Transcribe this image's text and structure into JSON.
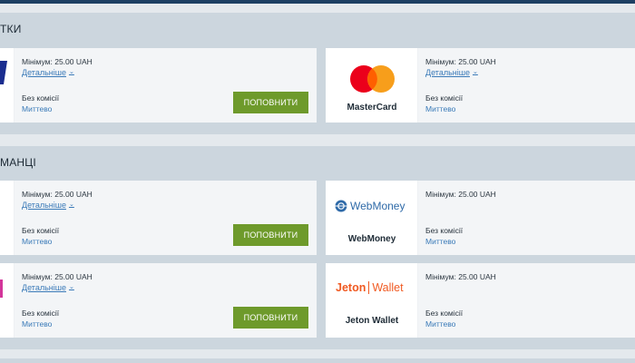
{
  "sections": [
    {
      "title": "ТКИ",
      "cards": [
        {
          "min": "Мінімум: 25.00 UAH",
          "more": "Детальніше",
          "fee": "Без комісії",
          "speed": "Миттево",
          "button": "ПОПОВНИТИ",
          "logo": "visa-partial"
        },
        {
          "min": "Мінімум: 25.00 UAH",
          "more": "Детальніше",
          "fee": "Без комісії",
          "speed": "Миттево",
          "name": "MasterCard",
          "logo": "mastercard"
        }
      ]
    },
    {
      "title": "МАНЦІ",
      "cards": [
        {
          "min": "Мінімум: 25.00 UAH",
          "more": "Детальніше",
          "fee": "Без комісії",
          "speed": "Миттево",
          "button": "ПОПОВНИТИ",
          "logo": "blank"
        },
        {
          "min": "Мінімум: 25.00 UAH",
          "fee": "Без комісії",
          "speed": "Миттево",
          "name": "WebMoney",
          "logo": "webmoney",
          "logo_text": "WebMoney"
        },
        {
          "min": "Мінімум: 25.00 UAH",
          "more": "Детальніше",
          "fee": "Без комісії",
          "speed": "Миттево",
          "button": "ПОПОВНИТИ",
          "logo": "pink-partial"
        },
        {
          "min": "Мінімум: 25.00 UAH",
          "fee": "Без комісії",
          "speed": "Миттево",
          "name": "Jeton Wallet",
          "logo": "jeton",
          "logo_text_a": "Jeton",
          "logo_text_b": "Wallet"
        }
      ]
    }
  ],
  "colors": {
    "button": "#6e9a2b",
    "link": "#3a7ab8",
    "header_band": "#ccd6de",
    "topbar": "#1d3f63",
    "jeton": "#f05a22",
    "webmoney": "#2f6aa8"
  }
}
